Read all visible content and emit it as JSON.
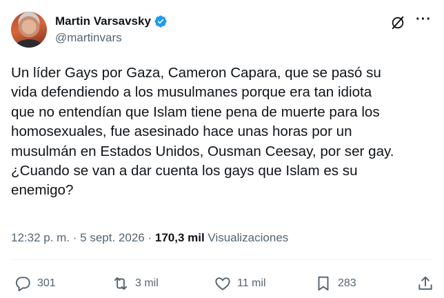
{
  "author": {
    "display_name": "Martin Varsavsky",
    "handle": "@martinvars",
    "verified": true,
    "verified_color": "#1d9bf0"
  },
  "header_icons": [
    "grok-icon",
    "more-icon"
  ],
  "more_label": "···",
  "tweet": {
    "text": "Un líder Gays por Gaza, Cameron Capara,  que se pasó su\nvida defendiendo a los musulmanes porque era tan idiota\nque no entendían que Islam tiene pena de muerte para los\nhomosexuales, fue asesinado hace unas horas por un\nmusulmán en Estados Unidos, Ousman Ceesay, por ser gay.\n¿Cuando se van a dar cuenta los gays que Islam es su\nenemigo?"
  },
  "meta": {
    "time": "12:32 p. m.",
    "sep1": " · ",
    "date": "5 sept. 2026",
    "sep2": " · ",
    "views_count": "170,3 mil",
    "views_label": " Visualizaciones"
  },
  "actions": {
    "reply_count": "301",
    "retweet_count": "3 mil",
    "like_count": "11 mil",
    "bookmark_count": "283"
  },
  "colors": {
    "text": "#0f1419",
    "secondary": "#536471",
    "divider": "#eff3f4"
  }
}
